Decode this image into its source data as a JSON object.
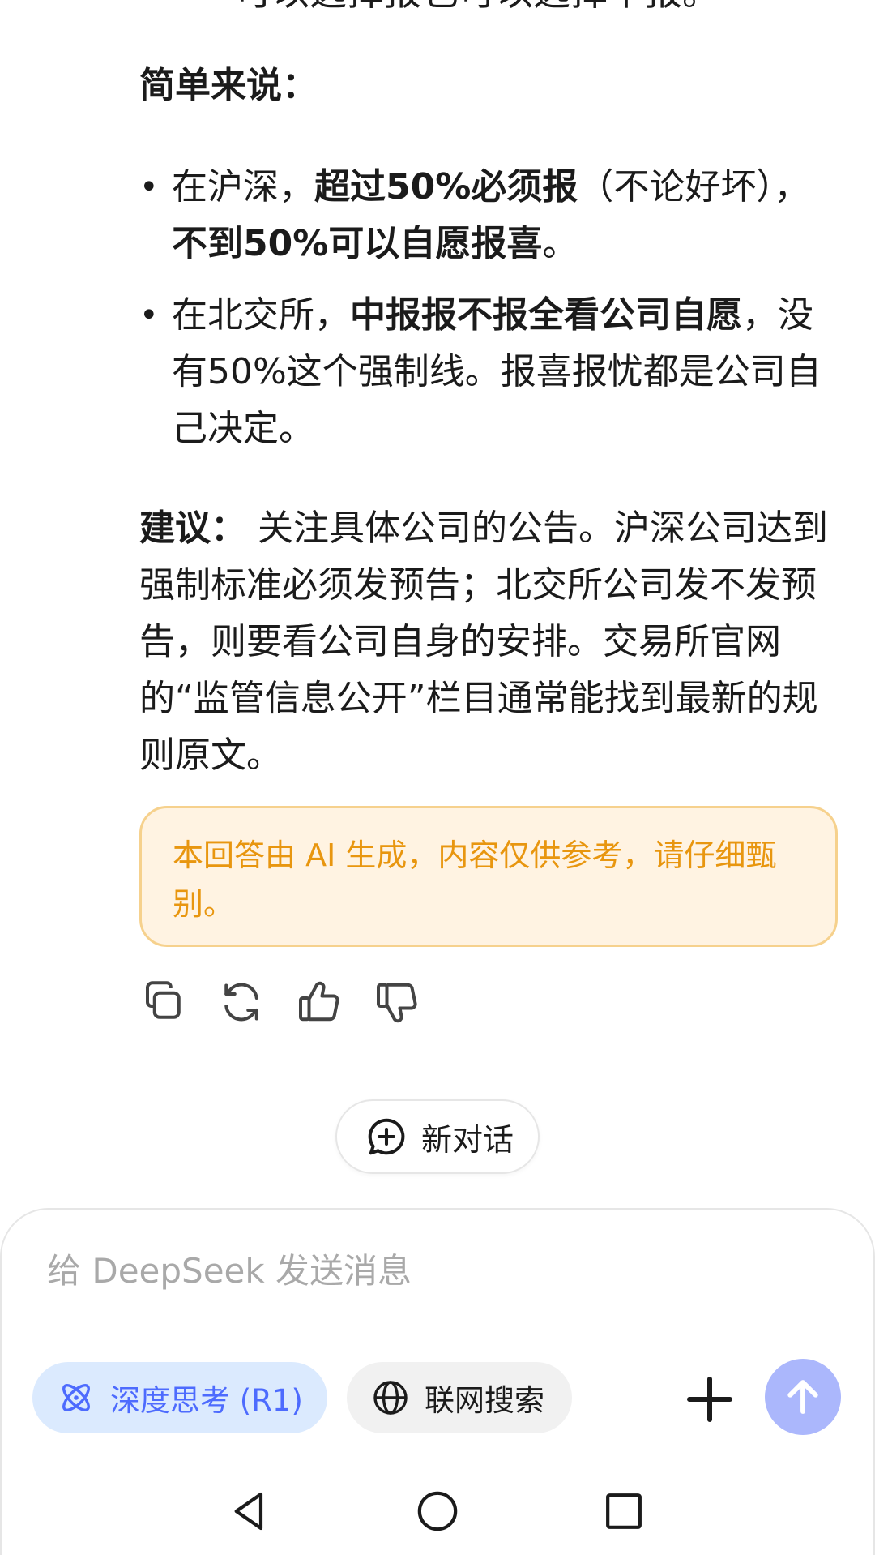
{
  "message": {
    "clipped_top_line": "可以选择报也可以选择不报。",
    "summary_heading": "简单来说：",
    "bullets": [
      {
        "pre": "在沪深，",
        "bold1": "超过50%必须报",
        "mid": "（不论好坏），",
        "bold2": "不到50%可以自愿报喜",
        "post": "。"
      },
      {
        "pre": "在北交所，",
        "bold1": "中报报不报全看公司自愿",
        "mid": "，没有50%这个强制线。报喜报忧都是公司自己决定。"
      }
    ],
    "advice_label": "建议：",
    "advice_text": " 关注具体公司的公告。沪深公司达到强制标准必须发预告；北交所公司发不发预告，则要看公司自身的安排。交易所官网的“监管信息公开”栏目通常能找到最新的规则原文。",
    "disclaimer": "本回答由 AI 生成，内容仅供参考，请仔细甄别。"
  },
  "actions": {
    "copy": "copy-icon",
    "regenerate": "refresh-icon",
    "like": "thumbs-up-icon",
    "dislike": "thumbs-down-icon"
  },
  "new_chat": {
    "label": "新对话"
  },
  "composer": {
    "placeholder": "给 DeepSeek 发送消息",
    "deep_think_label": "深度思考 (R1)",
    "web_search_label": "联网搜索"
  },
  "colors": {
    "accent": "#4d6bfe",
    "accent_bg": "#dbeafe",
    "send_button": "#abb7fc",
    "disclaimer_text": "#e8960f",
    "disclaimer_bg": "#fff3e2"
  }
}
